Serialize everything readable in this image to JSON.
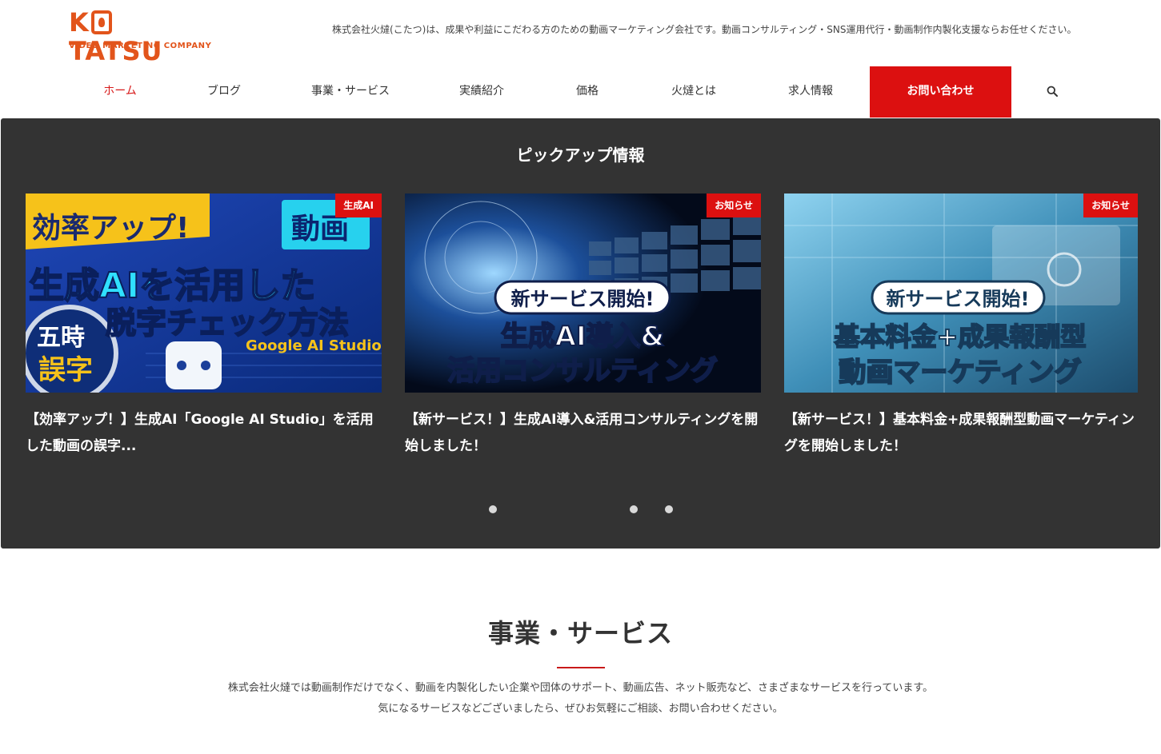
{
  "header": {
    "logo": {
      "word_left": "K",
      "word_right": "TATSU",
      "sub": "VIDEO MARKETING COMPANY"
    },
    "tagline": "株式会社火燵(こたつ)は、成果や利益にこだわる方のための動画マーケティング会社です。動画コンサルティング・SNS運用代行・動画制作内製化支援ならお任せください。"
  },
  "nav": {
    "items": [
      {
        "label": "ホーム",
        "active": true
      },
      {
        "label": "ブログ"
      },
      {
        "label": "事業・サービス"
      },
      {
        "label": "実績紹介"
      },
      {
        "label": "価格"
      },
      {
        "label": "火燵とは"
      },
      {
        "label": "求人情報"
      }
    ],
    "cta": "お問い合わせ",
    "search_icon": "search-icon"
  },
  "pickup": {
    "title": "ピックアップ情報",
    "cards": [
      {
        "category": "生成AI",
        "title": "【効率アップ！】生成AI「Google AI Studio」を活用した動画の誤字...",
        "thumb_text": {
          "tag": "動画",
          "line1": "効率アップ!",
          "line2": "生成AIを活用した",
          "line3": "脱字チェック方法",
          "sub": "Google AI Studio",
          "corner": "五時",
          "corner2": "誤字"
        }
      },
      {
        "category": "お知らせ",
        "title": "【新サービス！】生成AI導入&活用コンサルティングを開始しました！",
        "thumb_text": {
          "pill": "新サービス開始!",
          "line1": "生成AI導入&",
          "line2": "活用コンサルティング"
        }
      },
      {
        "category": "お知らせ",
        "title": "【新サービス！】基本料金+成果報酬型動画マーケティングを開始しました！",
        "thumb_text": {
          "pill": "新サービス開始!",
          "line1": "基本料金+成果報酬型",
          "line2": "動画マーケティング"
        }
      }
    ],
    "dots": 3
  },
  "business": {
    "title": "事業・サービス",
    "text1": "株式会社火燵では動画制作だけでなく、動画を内製化したい企業や団体のサポート、動画広告、ネット販売など、さまざまなサービスを行っています。",
    "text2": "気になるサービスなどございましたら、ぜひお気軽にご相談、お問い合わせください。"
  },
  "colors": {
    "brand": "#e2541b",
    "accent_red": "#dc1010",
    "pickup_bg": "#333333"
  }
}
